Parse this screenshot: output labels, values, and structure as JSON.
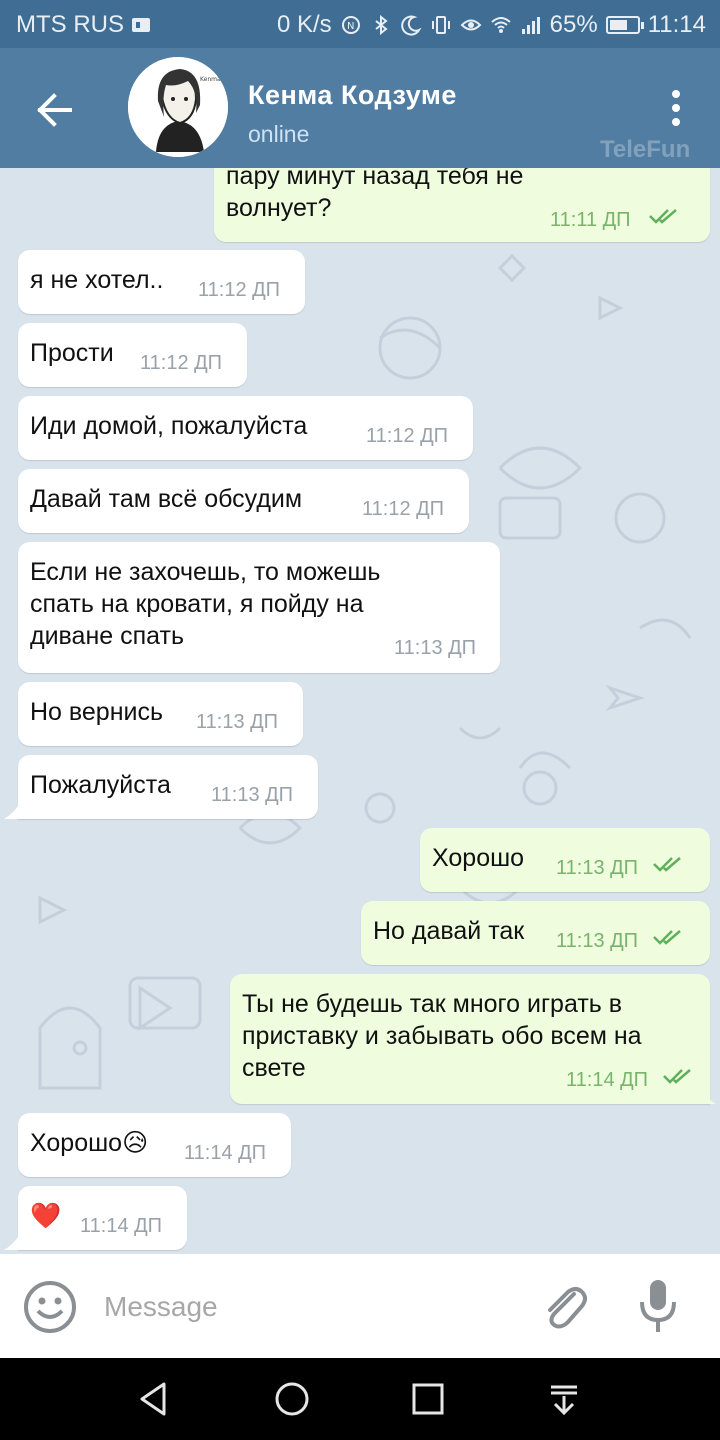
{
  "status_bar": {
    "carrier": "MTS RUS",
    "net_speed": "0 K/s",
    "battery": "65%",
    "battery_level": 0.65,
    "time": "11:14"
  },
  "header": {
    "contact_name": "Кенма  Кодзуме",
    "status": "online",
    "watermark": "TeleFun"
  },
  "messages": [
    {
      "direction": "out",
      "text": "пару минут назад тебя не волнует?",
      "time": "11:11 ДП",
      "read": true
    },
    {
      "direction": "in",
      "text": "я не хотел..",
      "time": "11:12 ДП"
    },
    {
      "direction": "in",
      "text": "Прости",
      "time": "11:12 ДП"
    },
    {
      "direction": "in",
      "text": "Иди домой, пожалуйста",
      "time": "11:12 ДП"
    },
    {
      "direction": "in",
      "text": "Давай там всё обсудим",
      "time": "11:12 ДП"
    },
    {
      "direction": "in",
      "text": "Если не захочешь, то можешь спать на кровати, я пойду на диване спать",
      "time": "11:13 ДП"
    },
    {
      "direction": "in",
      "text": "Но вернись",
      "time": "11:13 ДП"
    },
    {
      "direction": "in",
      "text": "Пожалуйста",
      "time": "11:13 ДП"
    },
    {
      "direction": "out",
      "text": "Хорошо",
      "time": "11:13 ДП",
      "read": true
    },
    {
      "direction": "out",
      "text": "Но давай так",
      "time": "11:13 ДП",
      "read": true
    },
    {
      "direction": "out",
      "text": "Ты не будешь так много играть в приставку и забывать обо всем на свете",
      "time": "11:14 ДП",
      "read": true
    },
    {
      "direction": "in",
      "text": "Хорошо😥",
      "time": "11:14 ДП"
    },
    {
      "direction": "in",
      "text": "❤️",
      "time": "11:14 ДП"
    }
  ],
  "input": {
    "placeholder": "Message",
    "value": ""
  },
  "colors": {
    "header": "#517da2",
    "status_bar": "#3f6d93",
    "outgoing_bubble": "#effdde",
    "incoming_bubble": "#ffffff",
    "read_ticks": "#5fb05a"
  }
}
